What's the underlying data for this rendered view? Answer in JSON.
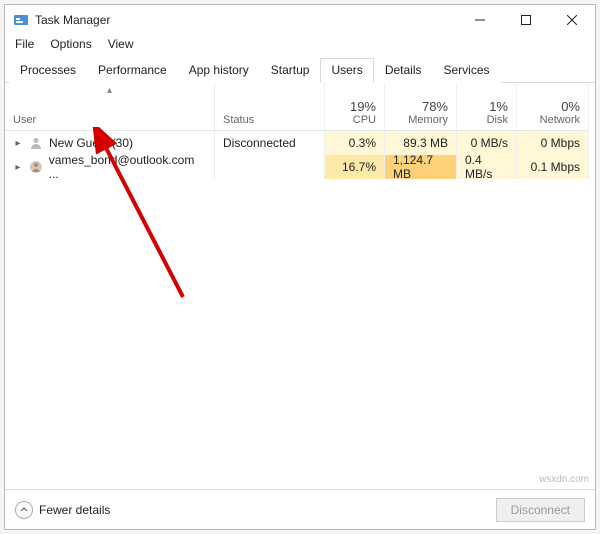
{
  "window": {
    "title": "Task Manager"
  },
  "menu": {
    "file": "File",
    "options": "Options",
    "view": "View"
  },
  "tabs": {
    "processes": "Processes",
    "performance": "Performance",
    "app_history": "App history",
    "startup": "Startup",
    "users": "Users",
    "details": "Details",
    "services": "Services"
  },
  "columns": {
    "user": "User",
    "status": "Status",
    "cpu": {
      "pct": "19%",
      "label": "CPU"
    },
    "memory": {
      "pct": "78%",
      "label": "Memory"
    },
    "disk": {
      "pct": "1%",
      "label": "Disk"
    },
    "network": {
      "pct": "0%",
      "label": "Network"
    }
  },
  "rows": [
    {
      "user": "New Guest (30)",
      "status": "Disconnected",
      "cpu": "0.3%",
      "memory": "89.3 MB",
      "disk": "0 MB/s",
      "network": "0 Mbps",
      "heat": {
        "cpu": "heat-low",
        "memory": "heat-low",
        "disk": "heat-low",
        "network": "heat-low"
      }
    },
    {
      "user": "vames_bond@outlook.com ...",
      "status": "",
      "cpu": "16.7%",
      "memory": "1,124.7 MB",
      "disk": "0.4 MB/s",
      "network": "0.1 Mbps",
      "heat": {
        "cpu": "heat-mid",
        "memory": "heat-high",
        "disk": "heat-low",
        "network": "heat-low"
      }
    }
  ],
  "footer": {
    "fewer": "Fewer details",
    "disconnect": "Disconnect"
  },
  "watermark": "wsxdn.com"
}
